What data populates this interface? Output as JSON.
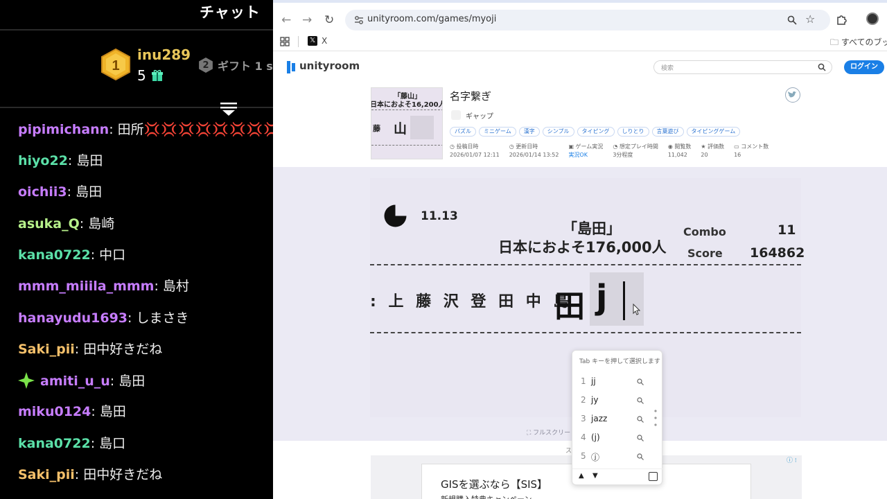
{
  "chat": {
    "title": "チャット",
    "top_gifter": {
      "rank": "1",
      "user": "inu289",
      "count": "5"
    },
    "second_gifter": {
      "rank": "2",
      "text": "ギフト 1 s"
    },
    "messages": [
      {
        "user": "pipimichann",
        "text": "田所",
        "hearts": "💢💢💢💢💢💢💢💢",
        "color": "#c77dff"
      },
      {
        "user": "hiyo22",
        "text": "島田",
        "color": "#5be0a8"
      },
      {
        "user": "oichii3",
        "text": "島田",
        "color": "#c77dff"
      },
      {
        "user": "asuka_Q",
        "text": "島崎",
        "color": "#b6f08a"
      },
      {
        "user": "kana0722",
        "text": "中口",
        "color": "#5be0a8"
      },
      {
        "user": "mmm_miiila_mmm",
        "text": "島村",
        "color": "#c77dff"
      },
      {
        "user": "hanayudu1693",
        "text": "しまさき",
        "color": "#c77dff"
      },
      {
        "user": "Saki_pii",
        "text": "田中好きだね",
        "color": "#f5c06a"
      },
      {
        "user": "amiti_u_u",
        "text": "島田",
        "color": "#c77dff"
      },
      {
        "user": "miku0124",
        "text": "島田",
        "color": "#c77dff"
      },
      {
        "user": "kana0722",
        "text": "島口",
        "color": "#5be0a8"
      },
      {
        "user": "Saki_pii",
        "text": "田中好きだね",
        "color": "#f5c06a"
      }
    ]
  },
  "browser": {
    "url": "unityroom.com/games/myoji",
    "bookmark_x": "X",
    "all_bookmarks": "すべてのブックマ"
  },
  "site": {
    "logo": "unityroom",
    "search_placeholder": "検索",
    "login": "ログイン"
  },
  "game_info": {
    "thumb_line1": "「藤山」",
    "thumb_line2": "日本におよそ16,200人",
    "thumb_k1": "藤",
    "thumb_k2": "山",
    "title": "名字繋ぎ",
    "author": "ギャップ",
    "tags": [
      "パズル",
      "ミニゲーム",
      "漢字",
      "シンプル",
      "タイピング",
      "しりとり",
      "言葉遊び",
      "タイピングゲーム"
    ],
    "stats": [
      {
        "label": "投稿日時",
        "value": "2026/01/07 12:11"
      },
      {
        "label": "更新日時",
        "value": "2026/01/14 13:52"
      },
      {
        "label": "ゲーム実況",
        "value": "実況OK",
        "blue": true
      },
      {
        "label": "想定プレイ時間",
        "value": "3分程度"
      },
      {
        "label": "閲覧数",
        "value": "11,042"
      },
      {
        "label": "評価数",
        "value": "20"
      },
      {
        "label": "コメント数",
        "value": "16"
      }
    ]
  },
  "game": {
    "timer": "11.13",
    "timer_remaining_fraction": 0.25,
    "question_name": "「島田」",
    "question_pop": "日本におよそ176,000人",
    "combo_label": "Combo",
    "combo_value": "11",
    "score_label": "Score",
    "score_value": "164862",
    "chain": ": 上 藤 沢 登 田 中 島",
    "current_kanji": "田",
    "input": "j",
    "fullscreen": "フルスクリー",
    "below_label": "ス"
  },
  "ime": {
    "hint": "Tab キーを押して選択します",
    "candidates": [
      {
        "n": "1",
        "w": "jj"
      },
      {
        "n": "2",
        "w": "jy"
      },
      {
        "n": "3",
        "w": "jazz"
      },
      {
        "n": "4",
        "w": "(j)"
      },
      {
        "n": "5",
        "w": "ⓙ"
      }
    ]
  },
  "ad": {
    "title": "GISを選ぶなら【SIS】",
    "sub": "新規購入特典キャンペーン"
  }
}
